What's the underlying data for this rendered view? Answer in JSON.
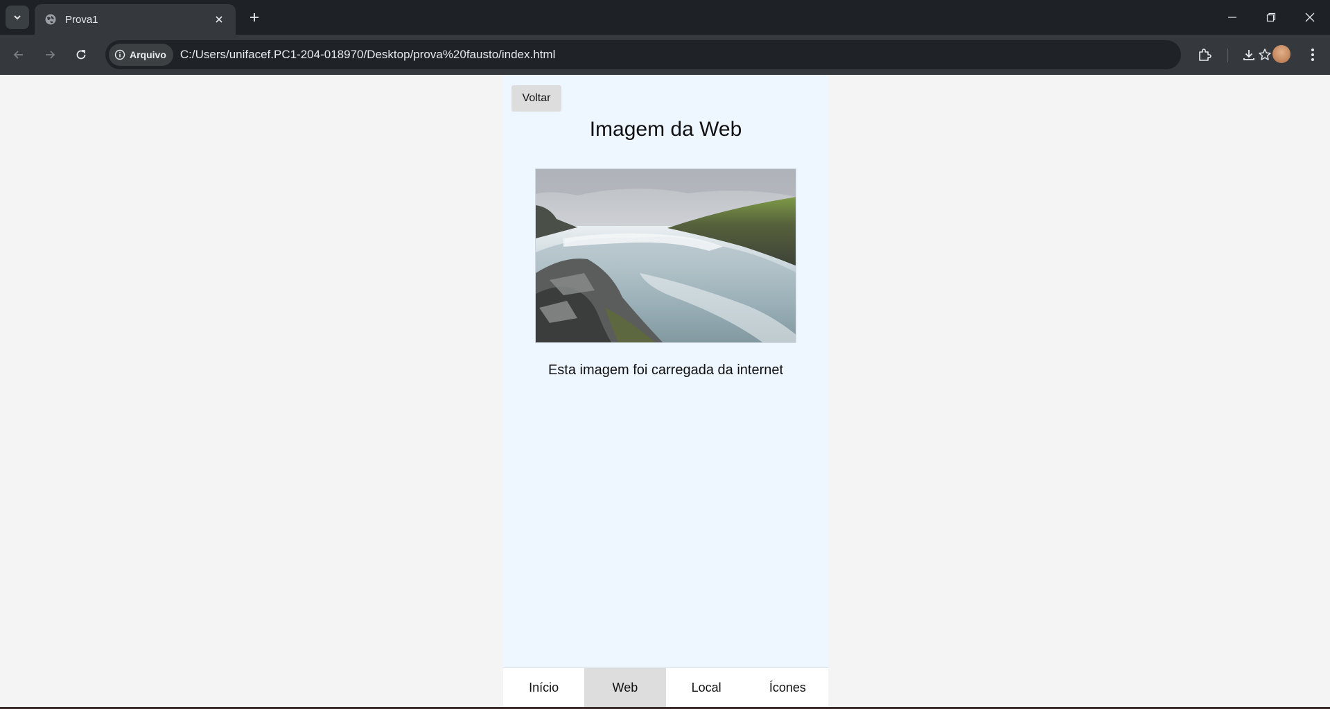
{
  "browser": {
    "tab_title": "Prova1",
    "address_chip": "Arquivo",
    "url": "C:/Users/unifacef.PC1-204-018970/Desktop/prova%20fausto/index.html"
  },
  "page": {
    "back_label": "Voltar",
    "heading": "Imagem da Web",
    "image_alt": "waterfall",
    "caption": "Esta imagem foi carregada da internet"
  },
  "bottom_nav": {
    "items": [
      {
        "label": "Início",
        "active": false
      },
      {
        "label": "Web",
        "active": true
      },
      {
        "label": "Local",
        "active": false
      },
      {
        "label": "Ícones",
        "active": false
      }
    ]
  },
  "colors": {
    "panel_bg": "#eef6ff",
    "page_bg": "#f4f4f4",
    "active_nav": "#dddddd",
    "chrome_dark": "#1e2226",
    "chrome_toolbar": "#35393d"
  }
}
